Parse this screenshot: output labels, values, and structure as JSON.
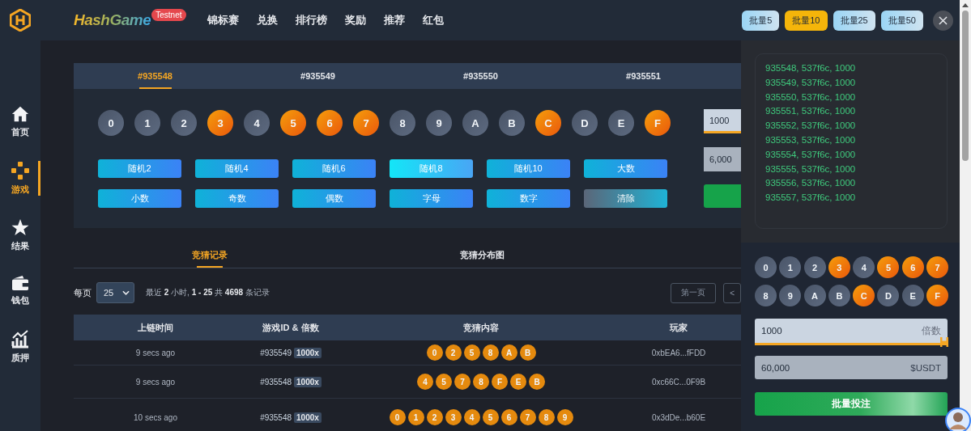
{
  "top_bar": {
    "brand": "HashGame",
    "badge": "Testnet",
    "nav": [
      "锦标赛",
      "兑换",
      "排行榜",
      "奖励",
      "推荐",
      "红包"
    ],
    "batch_buttons": [
      {
        "label": "批量5",
        "selected": false
      },
      {
        "label": "批量10",
        "selected": true
      },
      {
        "label": "批量25",
        "selected": false
      },
      {
        "label": "批量50",
        "selected": false
      }
    ]
  },
  "sidebar": {
    "items": [
      {
        "label": "首页",
        "selected": false
      },
      {
        "label": "游戏",
        "selected": true
      },
      {
        "label": "结果",
        "selected": false
      },
      {
        "label": "钱包",
        "selected": false
      },
      {
        "label": "质押",
        "selected": false
      }
    ]
  },
  "round_tabs": [
    {
      "label": "#935548",
      "selected": true
    },
    {
      "label": "#935549",
      "selected": false
    },
    {
      "label": "#935550",
      "selected": false
    },
    {
      "label": "#935551",
      "selected": false
    }
  ],
  "digit_balls": [
    {
      "label": "0",
      "selected": false
    },
    {
      "label": "1",
      "selected": false
    },
    {
      "label": "2",
      "selected": false
    },
    {
      "label": "3",
      "selected": true
    },
    {
      "label": "4",
      "selected": false
    },
    {
      "label": "5",
      "selected": true
    },
    {
      "label": "6",
      "selected": true
    },
    {
      "label": "7",
      "selected": true
    },
    {
      "label": "8",
      "selected": false
    },
    {
      "label": "9",
      "selected": false
    },
    {
      "label": "A",
      "selected": false
    },
    {
      "label": "B",
      "selected": false
    },
    {
      "label": "C",
      "selected": true
    },
    {
      "label": "D",
      "selected": false
    },
    {
      "label": "E",
      "selected": false
    },
    {
      "label": "F",
      "selected": true
    }
  ],
  "quick_picks": [
    {
      "label": "随机2",
      "kind": "pick",
      "selected": false
    },
    {
      "label": "随机4",
      "kind": "pick",
      "selected": false
    },
    {
      "label": "随机6",
      "kind": "pick",
      "selected": false
    },
    {
      "label": "随机8",
      "kind": "pick",
      "selected": true
    },
    {
      "label": "随机10",
      "kind": "pick",
      "selected": false
    },
    {
      "label": "大数",
      "kind": "pick",
      "selected": false
    },
    {
      "label": "小数",
      "kind": "pick",
      "selected": false
    },
    {
      "label": "奇数",
      "kind": "pick",
      "selected": false
    },
    {
      "label": "偶数",
      "kind": "pick",
      "selected": false
    },
    {
      "label": "字母",
      "kind": "pick",
      "selected": false
    },
    {
      "label": "数字",
      "kind": "pick",
      "selected": false
    },
    {
      "label": "清除",
      "kind": "clear",
      "selected": false
    }
  ],
  "bet_panel": {
    "multiplier": "1000",
    "amount": "6,000"
  },
  "record_tabs": [
    {
      "label": "竞猜记录",
      "selected": true
    },
    {
      "label": "竞猜分布图",
      "selected": false
    }
  ],
  "records_toolbar": {
    "per_page_label": "每页",
    "per_page": "25",
    "summary": "最近 **2** 小时, **1 - 25** 共 **4698** 条记录",
    "pager": [
      "第一页",
      "<"
    ]
  },
  "table": {
    "columns": [
      "上链时间",
      "游戏ID & 倍数",
      "竞猜内容",
      "玩家"
    ],
    "rows": [
      {
        "time": "9 secs ago",
        "game_id": "#935549",
        "multiplier": "1000x",
        "guesses": [
          "0",
          "2",
          "5",
          "8",
          "A",
          "B"
        ],
        "player": "0xbEA6...fFDD"
      },
      {
        "time": "9 secs ago",
        "game_id": "#935548",
        "multiplier": "1000x",
        "guesses": [
          "4",
          "5",
          "7",
          "8",
          "F",
          "E",
          "B"
        ],
        "player": "0xc66C...0F9B"
      },
      {
        "time": "10 secs ago",
        "game_id": "#935548",
        "multiplier": "1000x",
        "guesses": [
          "0",
          "1",
          "2",
          "3",
          "4",
          "5",
          "6",
          "7",
          "8",
          "9"
        ],
        "player": "0x3dDe...b60E"
      }
    ]
  },
  "batch_panel": {
    "entries": [
      "935548, 537f6c, 1000",
      "935549, 537f6c, 1000",
      "935550, 537f6c, 1000",
      "935551, 537f6c, 1000",
      "935552, 537f6c, 1000",
      "935553, 537f6c, 1000",
      "935554, 537f6c, 1000",
      "935555, 537f6c, 1000",
      "935556, 537f6c, 1000",
      "935557, 537f6c, 1000"
    ],
    "balls": [
      {
        "label": "0",
        "selected": false
      },
      {
        "label": "1",
        "selected": false
      },
      {
        "label": "2",
        "selected": false
      },
      {
        "label": "3",
        "selected": true
      },
      {
        "label": "4",
        "selected": false
      },
      {
        "label": "5",
        "selected": true
      },
      {
        "label": "6",
        "selected": true
      },
      {
        "label": "7",
        "selected": true
      },
      {
        "label": "8",
        "selected": false
      },
      {
        "label": "9",
        "selected": false
      },
      {
        "label": "A",
        "selected": false
      },
      {
        "label": "B",
        "selected": false
      },
      {
        "label": "C",
        "selected": true
      },
      {
        "label": "D",
        "selected": false
      },
      {
        "label": "E",
        "selected": false
      },
      {
        "label": "F",
        "selected": true
      }
    ],
    "multiplier": {
      "value": "1000",
      "unit": "倍数",
      "level": 1
    },
    "amount": {
      "value": "60,000",
      "unit": "$USDT"
    },
    "submit": "批量投注"
  }
}
